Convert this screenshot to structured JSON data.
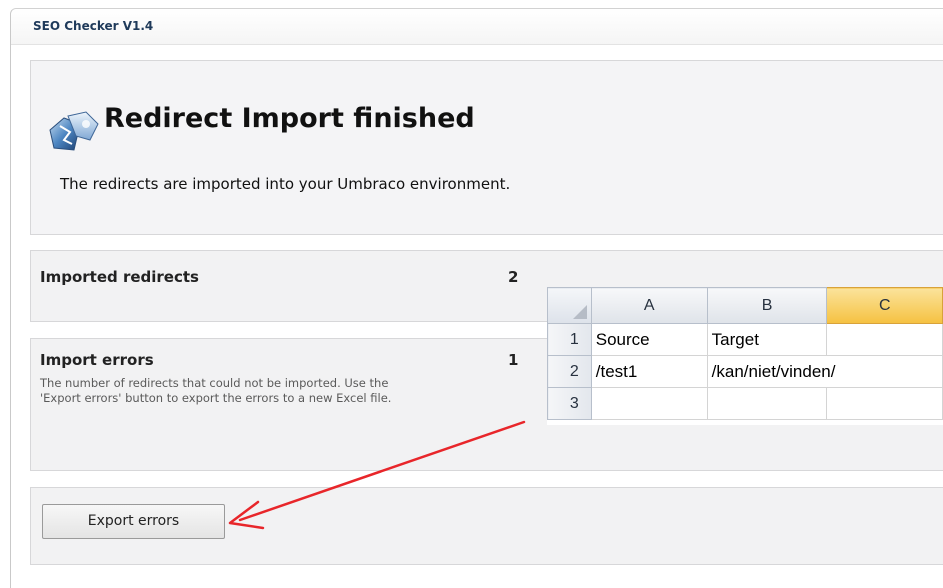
{
  "window": {
    "title": "SEO Checker V1.4"
  },
  "header": {
    "icon": "seo-checker-logo-icon",
    "title": "Redirect Import finished",
    "subtitle": "The redirects are imported into your Umbraco environment."
  },
  "stats": {
    "imported": {
      "label": "Imported redirects",
      "value": "2"
    },
    "errors": {
      "label": "Import errors",
      "value": "1",
      "description": "The number of redirects that could not be imported. Use the 'Export errors' button to export the errors to a new Excel file."
    }
  },
  "actions": {
    "export_label": "Export errors"
  },
  "excel": {
    "columns": [
      "A",
      "B",
      "C"
    ],
    "selected_column": "C",
    "rows": [
      {
        "num": "1",
        "cells": [
          "Source",
          "Target",
          ""
        ]
      },
      {
        "num": "2",
        "cells": [
          "/test1",
          "/kan/niet/vinden/",
          ""
        ]
      },
      {
        "num": "3",
        "cells": [
          "",
          "",
          ""
        ]
      }
    ]
  },
  "colors": {
    "title_blue": "#1f3a5a",
    "panel_bg": "#f2f2f3",
    "arrow_red": "#e8262a",
    "selected_column": "#f5c141"
  }
}
